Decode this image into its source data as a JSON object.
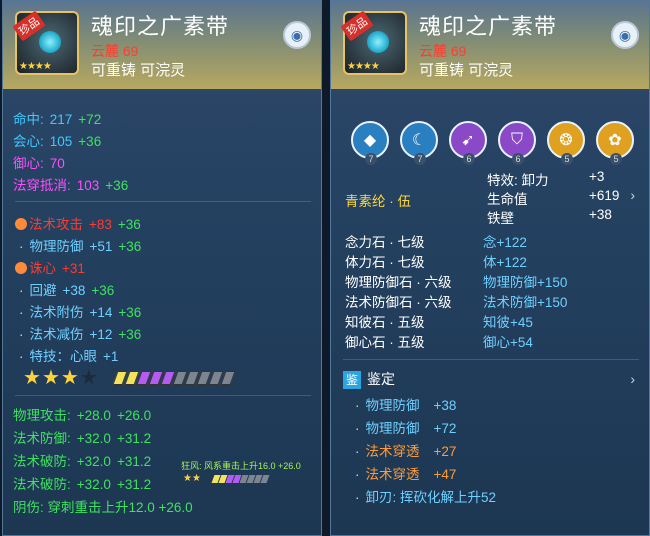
{
  "left_panel": {
    "item": {
      "name": "魂印之广素带",
      "badge": "珍品",
      "level_text": "云麓  69",
      "tags": "可重铸  可浣灵"
    },
    "base_stats": [
      {
        "label": "命中:",
        "value": "217",
        "bonus": "+72"
      },
      {
        "label": "会心:",
        "value": "105",
        "bonus": "+36"
      },
      {
        "label": "御心:",
        "value": "70",
        "bonus": ""
      },
      {
        "label": "法穿抵消:",
        "value": "103",
        "bonus": "+36"
      }
    ],
    "affixes": [
      {
        "label": "法术攻击",
        "value": "+83",
        "bonus": "+36",
        "marker": "dot"
      },
      {
        "label": "物理防御",
        "value": "+51",
        "bonus": "+36",
        "marker": "bullet"
      },
      {
        "label": "诛心",
        "value": "+31",
        "bonus": "",
        "marker": "dot"
      },
      {
        "label": "回避",
        "value": "+38",
        "bonus": "+36",
        "marker": "bullet"
      },
      {
        "label": "法术附伤",
        "value": "+14",
        "bonus": "+36",
        "marker": "bullet"
      },
      {
        "label": "法术减伤",
        "value": "+12",
        "bonus": "+36",
        "marker": "bullet"
      },
      {
        "label": "特技：心眼",
        "value": "+1",
        "bonus": "",
        "marker": "bullet"
      }
    ],
    "stars": {
      "filled": 3,
      "total": 4
    },
    "refine_lines": [
      {
        "label": "物理攻击:",
        "a": "+28.0",
        "b": "+26.0"
      },
      {
        "label": "法术防御:",
        "a": "+32.0",
        "b": "+31.2"
      },
      {
        "label": "法术破防:",
        "a": "+32.0",
        "b": "+31.2"
      },
      {
        "label": "法术破防:",
        "a": "+32.0",
        "b": "+31.2"
      }
    ],
    "mini_note": "狂风: 风系重击上升16.0 +26.0",
    "mini_stars": "★★",
    "last_line": "阴伤: 穿刺重击上升12.0  +26.0"
  },
  "right_panel": {
    "item": {
      "name": "魂印之广素带",
      "badge": "珍品",
      "level_text": "云麓  69",
      "tags": "可重铸  可浣灵"
    },
    "gem_slots": [
      {
        "icon": "stone-icon",
        "num": "7"
      },
      {
        "icon": "moon-icon",
        "num": "7"
      },
      {
        "icon": "arrow-icon",
        "num": "6"
      },
      {
        "icon": "shield-icon",
        "num": "6"
      },
      {
        "icon": "swirl-icon",
        "num": "5"
      },
      {
        "icon": "dots-icon",
        "num": "5"
      }
    ],
    "set_name": "青素纶 · 伍",
    "effects": [
      {
        "label": "特效: 卸力",
        "value": "+3"
      },
      {
        "label": "生命值",
        "value": "+619"
      },
      {
        "label": "铁壁",
        "value": "+38"
      }
    ],
    "stones": [
      {
        "label": "念力石 · 七级",
        "bonus": "念+122"
      },
      {
        "label": "体力石 · 七级",
        "bonus": "体+122"
      },
      {
        "label": "物理防御石 · 六级",
        "bonus": "物理防御+150"
      },
      {
        "label": "法术防御石 · 六级",
        "bonus": "法术防御+150"
      },
      {
        "label": "知彼石 · 五级",
        "bonus": "知彼+45"
      },
      {
        "label": "御心石 · 五级",
        "bonus": "御心+54"
      }
    ],
    "appraisal": {
      "badge": "鉴",
      "title": "鉴定",
      "lines": [
        {
          "label": "物理防御",
          "value": "+38",
          "color": "blue"
        },
        {
          "label": "物理防御",
          "value": "+72",
          "color": "blue"
        },
        {
          "label": "法术穿透",
          "value": "+27",
          "color": "orange"
        },
        {
          "label": "法术穿透",
          "value": "+47",
          "color": "orange"
        },
        {
          "label": "卸刃: 挥砍化解上升52",
          "value": "",
          "color": "blue"
        }
      ]
    }
  }
}
